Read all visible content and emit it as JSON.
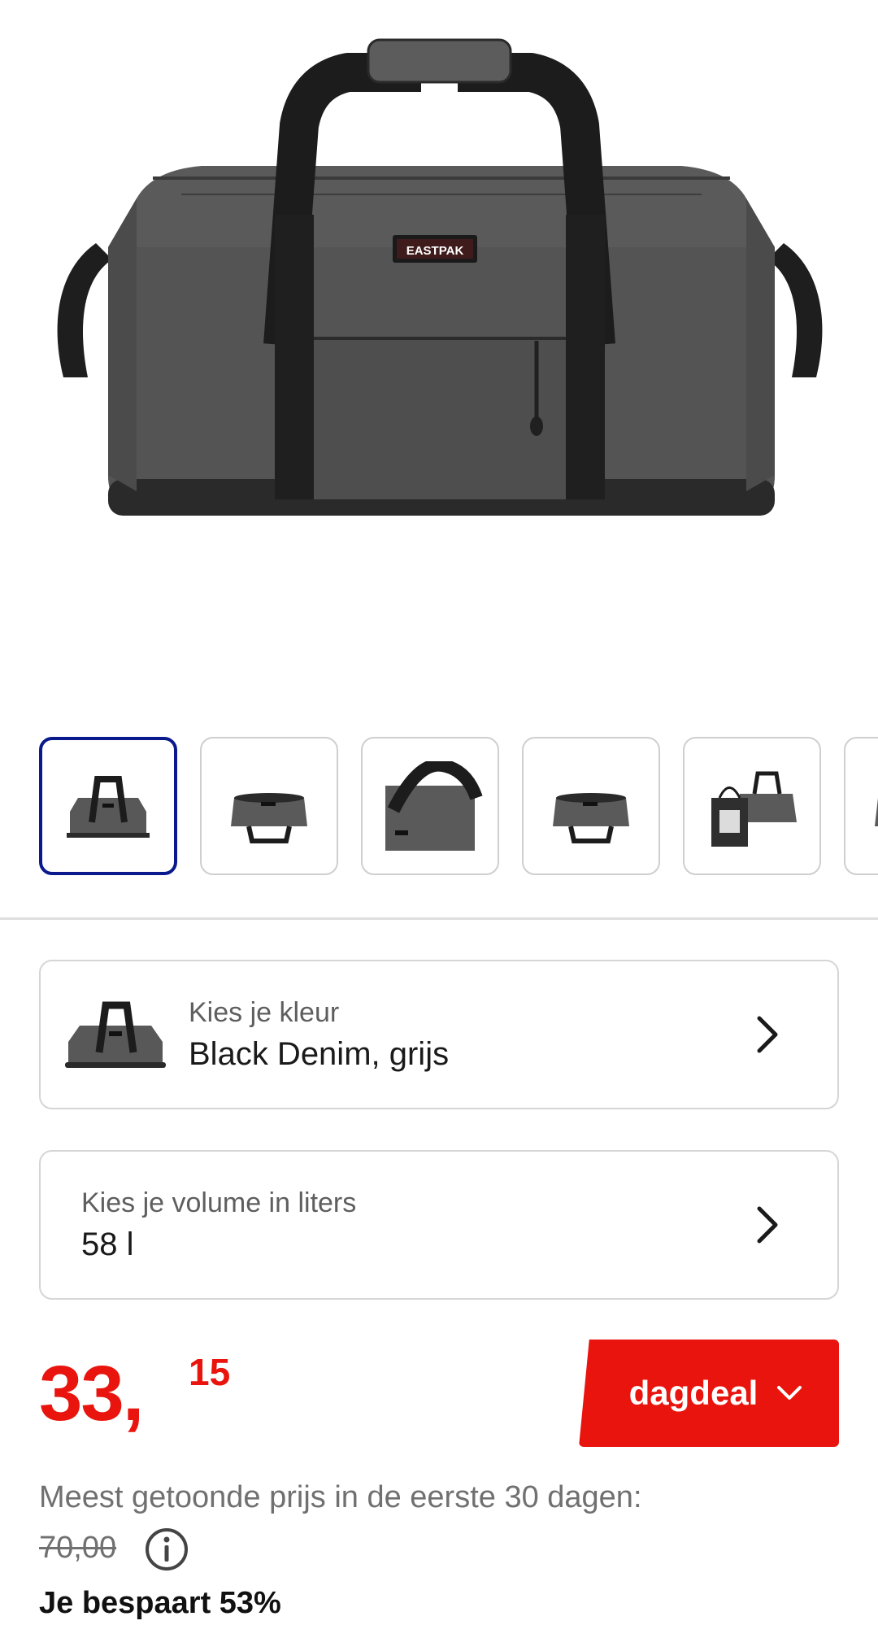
{
  "product": {
    "brand_label": "EASTPAK",
    "thumbnails": [
      "bag-front",
      "bag-open",
      "bag-strap-closeup",
      "bag-open-alt",
      "bag-with-tote",
      "bag-partial"
    ]
  },
  "color_option": {
    "label": "Kies je kleur",
    "value": "Black Denim, grijs"
  },
  "volume_option": {
    "label": "Kies je volume in liters",
    "value": "58 l"
  },
  "price": {
    "integer": "33,",
    "decimals": "15",
    "color": "#e8140d"
  },
  "deal_button": {
    "label": "dagdeal"
  },
  "price_note": "Meest getoonde prijs in de eerste 30 dagen:",
  "old_price": "70,00",
  "savings": "Je bespaart 53%",
  "colors": {
    "accent": "#e8140d",
    "selected_border": "#0a1a8c"
  }
}
